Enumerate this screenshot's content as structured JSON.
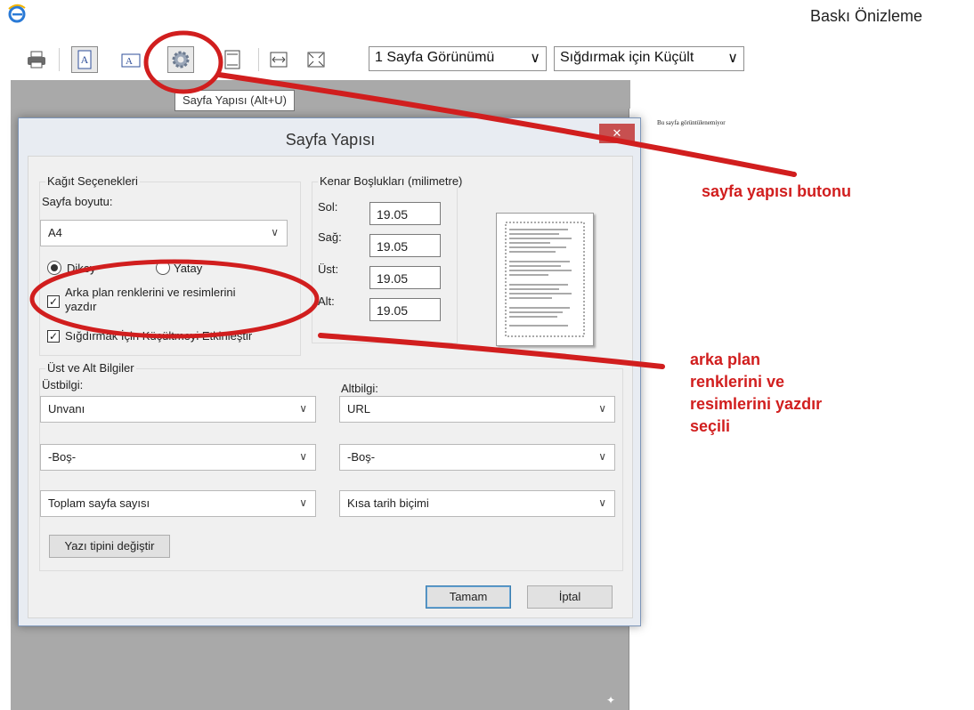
{
  "window": {
    "title": "Baskı Önizleme",
    "icon": "ie-icon"
  },
  "toolbar": {
    "view_select": "1 Sayfa Görünümü",
    "shrink_select": "Sığdırmak için Küçült",
    "tooltip": "Sayfa Yapısı (Alt+U)"
  },
  "preview": {
    "page_message": "Bu sayfa görüntülenemiyor"
  },
  "dialog": {
    "title": "Sayfa Yapısı",
    "close_glyph": "✕",
    "paper_options": {
      "title": "Kağıt Seçenekleri",
      "size_label": "Sayfa boyutu:",
      "size_value": "A4",
      "portrait_label": "Dikey",
      "landscape_label": "Yatay",
      "orientation_selected": "Dikey",
      "print_bg_label_1": "Arka plan renklerini ve resimlerini",
      "print_bg_label_2": "yazdır",
      "print_bg_checked": true,
      "shrink_label": "Sığdırmak İçin Küçültmeyi Etkinleştir",
      "shrink_checked": true
    },
    "margins": {
      "title": "Kenar Boşlukları (milimetre)",
      "left_label": "Sol:",
      "left_value": "19.05",
      "right_label": "Sağ:",
      "right_value": "19.05",
      "top_label": "Üst:",
      "top_value": "19.05",
      "bottom_label": "Alt:",
      "bottom_value": "19.05"
    },
    "headers_footers": {
      "title": "Üst ve Alt Bilgiler",
      "header_label": "Üstbilgi:",
      "footer_label": "Altbilgi:",
      "header_values": [
        "Unvanı",
        "-Boş-",
        "Toplam sayfa sayısı"
      ],
      "footer_values": [
        "URL",
        "-Boş-",
        "Kısa tarih biçimi"
      ],
      "font_button": "Yazı tipini değiştir"
    },
    "ok_button": "Tamam",
    "cancel_button": "İptal"
  },
  "annotations": {
    "color": "#d11e1e",
    "note_1": "sayfa yapısı butonu",
    "note_2_lines": [
      "arka plan",
      "renklerini ve",
      "resimlerini yazdır",
      "seçili"
    ]
  }
}
